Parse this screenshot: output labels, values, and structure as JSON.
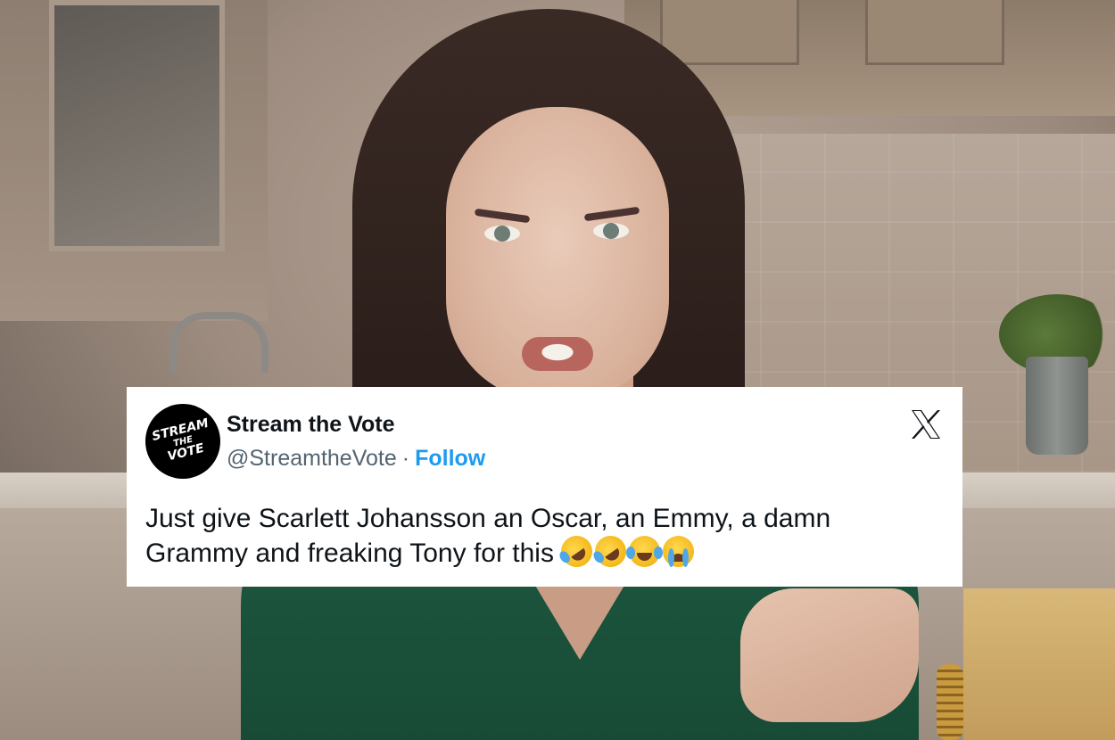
{
  "tweet": {
    "display_name": "Stream the Vote",
    "handle": "@StreamtheVote",
    "separator": "·",
    "follow_label": "Follow",
    "text": "Just give Scarlett Johansson an Oscar, an Emmy, a damn Grammy and freaking Tony for this",
    "emojis": [
      "rofl-emoji",
      "rofl-emoji",
      "tears-of-joy-emoji",
      "loudly-crying-emoji"
    ],
    "avatar_logo": {
      "line1": "STREAM",
      "line2": "THE",
      "line3": "VOTE"
    },
    "platform_icon": "x-logo-icon"
  },
  "colors": {
    "card_bg": "#ffffff",
    "name_text": "#0f1419",
    "handle_text": "#536471",
    "follow_link": "#1d9bf0",
    "shirt_green": "#1f5a41"
  }
}
